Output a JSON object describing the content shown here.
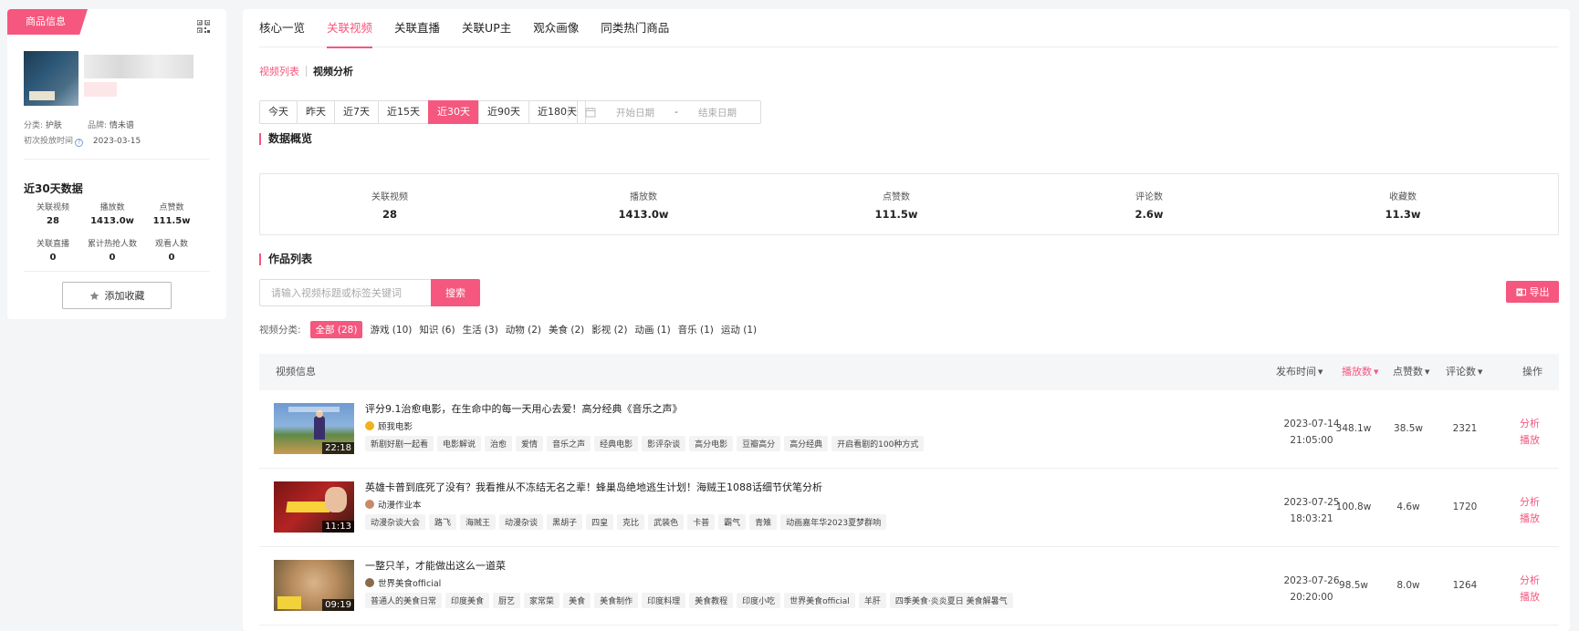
{
  "product": {
    "ribbon_label": "商品信息",
    "category_label": "分类:",
    "category": "护肤",
    "brand_label": "品牌:",
    "brand": "情未谱",
    "first_launch_label": "初次投放时间",
    "first_launch_date": "2023-03-15",
    "recent_title": "近30天数据",
    "stats": [
      {
        "label": "关联视频",
        "value": "28"
      },
      {
        "label": "播放数",
        "value": "1413.0w"
      },
      {
        "label": "点赞数",
        "value": "111.5w"
      },
      {
        "label": "关联直播",
        "value": "0"
      },
      {
        "label": "累计热抢人数",
        "value": "0"
      },
      {
        "label": "观看人数",
        "value": "0"
      }
    ],
    "fav_button": "添加收藏"
  },
  "tabs": [
    "核心一览",
    "关联视频",
    "关联直播",
    "关联UP主",
    "观众画像",
    "同类热门商品"
  ],
  "active_tab": 1,
  "subtabs": [
    "视频列表",
    "视频分析"
  ],
  "ranges": [
    "今天",
    "昨天",
    "近7天",
    "近15天",
    "近30天",
    "近90天",
    "近180天"
  ],
  "active_range": 4,
  "date": {
    "start_placeholder": "开始日期",
    "dash": "-",
    "end_placeholder": "结束日期"
  },
  "overview": {
    "title": "数据概览",
    "items": [
      {
        "label": "关联视频",
        "value": "28"
      },
      {
        "label": "播放数",
        "value": "1413.0w"
      },
      {
        "label": "点赞数",
        "value": "111.5w"
      },
      {
        "label": "评论数",
        "value": "2.6w"
      },
      {
        "label": "收藏数",
        "value": "11.3w"
      }
    ]
  },
  "works": {
    "title": "作品列表",
    "search_placeholder": "请输入视频标题或标签关键词",
    "search_button": "搜索",
    "export_button": "导出",
    "category_label": "视频分类:",
    "categories": [
      "全部 (28)",
      "游戏 (10)",
      "知识 (6)",
      "生活 (3)",
      "动物 (2)",
      "美食 (2)",
      "影视 (2)",
      "动画 (1)",
      "音乐 (1)",
      "运动 (1)"
    ],
    "active_category": 0
  },
  "table": {
    "headers": {
      "info": "视频信息",
      "time": "发布时间",
      "plays": "播放数",
      "likes": "点赞数",
      "comments": "评论数",
      "ops": "操作"
    },
    "rows": [
      {
        "title": "评分9.1治愈电影，在生命中的每一天用心去爱！高分经典《音乐之声》",
        "author": "顾我电影",
        "duration": "22:18",
        "tags": [
          "新剧好剧一起看",
          "电影解说",
          "治愈",
          "爱情",
          "音乐之声",
          "经典电影",
          "影评杂谈",
          "高分电影",
          "豆瓣高分",
          "高分经典",
          "开启看剧的100种方式"
        ],
        "date": "2023-07-14",
        "clock": "21:05:00",
        "plays": "348.1w",
        "likes": "38.5w",
        "comments": "2321",
        "op1": "分析",
        "op2": "播放"
      },
      {
        "title": "英雄卡普到底死了没有？我看推从不冻结无名之辈！蜂巢岛绝地逃生计划！海贼王1088话细节伏笔分析",
        "author": "动漫作业本",
        "duration": "11:13",
        "tags": [
          "动漫杂谈大会",
          "路飞",
          "海贼王",
          "动漫杂谈",
          "黑胡子",
          "四皇",
          "克比",
          "武装色",
          "卡普",
          "霸气",
          "青雉",
          "动画嘉年华2023夏梦群响"
        ],
        "date": "2023-07-25",
        "clock": "18:03:21",
        "plays": "100.8w",
        "likes": "4.6w",
        "comments": "1720",
        "op1": "分析",
        "op2": "播放"
      },
      {
        "title": "一整只羊，才能做出这么一道菜",
        "author": "世界美食official",
        "duration": "09:19",
        "tags": [
          "普通人的美食日常",
          "印度美食",
          "厨艺",
          "家常菜",
          "美食",
          "美食制作",
          "印度料理",
          "美食教程",
          "印度小吃",
          "世界美食official",
          "羊肝",
          "四季美食·炎炎夏日 美食解暑气"
        ],
        "date": "2023-07-26",
        "clock": "20:20:00",
        "plays": "98.5w",
        "likes": "8.0w",
        "comments": "1264",
        "op1": "分析",
        "op2": "播放"
      }
    ]
  },
  "colors": {
    "accent": "#f5577e"
  }
}
